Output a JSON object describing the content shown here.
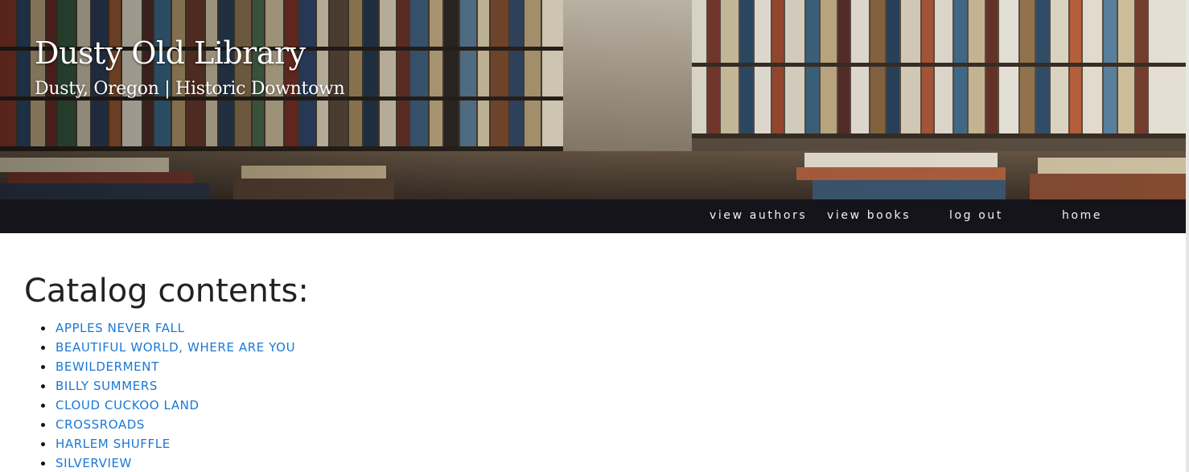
{
  "site": {
    "title": "Dusty Old Library",
    "subtitle": "Dusty, Oregon | Historic Downtown"
  },
  "nav": {
    "view_authors": "view authors",
    "view_books": "view books",
    "log_out": "log out",
    "home": "home"
  },
  "main": {
    "heading": "Catalog contents:",
    "books": [
      "APPLES NEVER FALL",
      "BEAUTIFUL WORLD, WHERE ARE YOU",
      "BEWILDERMENT",
      "BILLY SUMMERS",
      "CLOUD CUCKOO LAND",
      "CROSSROADS",
      "HARLEM SHUFFLE",
      "SILVERVIEW"
    ]
  },
  "colors": {
    "nav_background": "#15141b",
    "link_blue": "#1a78d6",
    "heading_text": "#222222"
  }
}
